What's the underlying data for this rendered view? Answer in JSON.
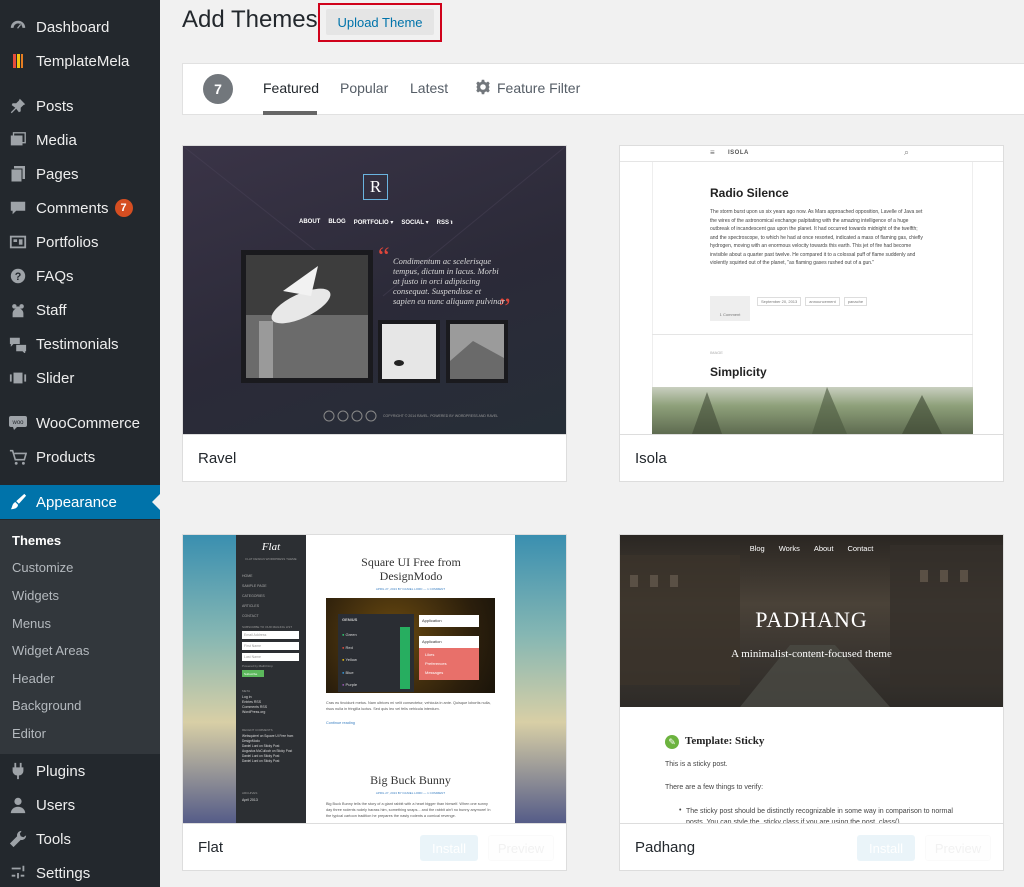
{
  "sidebar": {
    "items": [
      {
        "label": "Dashboard",
        "icon": "dashboard-icon"
      },
      {
        "label": "TemplateMela",
        "icon": "templatemela-icon"
      },
      {
        "label": "Posts",
        "icon": "pin-icon"
      },
      {
        "label": "Media",
        "icon": "media-icon"
      },
      {
        "label": "Pages",
        "icon": "pages-icon"
      },
      {
        "label": "Comments",
        "icon": "comment-icon",
        "badge": "7"
      },
      {
        "label": "Portfolios",
        "icon": "portfolio-icon"
      },
      {
        "label": "FAQs",
        "icon": "question-icon"
      },
      {
        "label": "Staff",
        "icon": "staff-icon"
      },
      {
        "label": "Testimonials",
        "icon": "testimonial-icon"
      },
      {
        "label": "Slider",
        "icon": "slider-icon"
      },
      {
        "label": "WooCommerce",
        "icon": "woocommerce-icon"
      },
      {
        "label": "Products",
        "icon": "cart-icon"
      },
      {
        "label": "Appearance",
        "icon": "brush-icon"
      },
      {
        "label": "Plugins",
        "icon": "plugin-icon"
      },
      {
        "label": "Users",
        "icon": "user-icon"
      },
      {
        "label": "Tools",
        "icon": "wrench-icon"
      },
      {
        "label": "Settings",
        "icon": "settings-icon"
      }
    ],
    "appearance_submenu": [
      "Themes",
      "Customize",
      "Widgets",
      "Menus",
      "Widget Areas",
      "Header",
      "Background",
      "Editor"
    ]
  },
  "header": {
    "title": "Add Themes",
    "upload_label": "Upload Theme"
  },
  "filter": {
    "count": "7",
    "tabs": [
      "Featured",
      "Popular",
      "Latest"
    ],
    "feature_filter": "Feature Filter"
  },
  "themes": [
    {
      "name": "Ravel",
      "preview": {
        "logo": "R",
        "nav": [
          "ABOUT",
          "BLOG",
          "PORTFOLIO ▾",
          "SOCIAL ▾",
          "RSS ℩"
        ],
        "quote": "Condimentum ac scelerisque tempus, dictum in lacus. Morbi at justo in orci adipiscing consequat. Suspendisse et sapien eu nunc aliquam pulvinar",
        "footer": "COPYRIGHT © 2014 RAVEL. POWERED BY WORDPRESS AND RAVEL"
      }
    },
    {
      "name": "Isola",
      "preview": {
        "brand": "ISOLA",
        "post_title": "Radio Silence",
        "post_body": "The storm burst upon us six years ago now. As Mars approached opposition, Lavelle of Java set the wires of the astronomical exchange palpitating with the amazing intelligence of a huge outbreak of incandescent gas upon the planet. It had occurred towards midnight of the twelfth; and the spectroscope, to which he had at once resorted, indicated a mass of flaming gas, chiefly hydrogen, moving with an enormous velocity towards this earth. This jet of fire had become invisible about a quarter past twelve. He compared it to a colossal puff of flame suddenly and violently squirted out of the planet, \"as flaming gases rushed out of a gun.\"",
        "meta": [
          "1 Comment",
          "September 20, 2013",
          "announcement",
          "panache"
        ],
        "second_kicker": "IMAGE",
        "second_title": "Simplicity"
      }
    },
    {
      "name": "Flat",
      "install": "Install",
      "preview_label": "Preview",
      "preview": {
        "logo": "Flat",
        "tagline": "FLAT DESIGN WORDPRESS THEME",
        "nav": [
          "HOME",
          "SAMPLE PAGE",
          "CATEGORIES",
          "ARTICLES",
          "CONTACT"
        ],
        "subscribe_heading": "SUBSCRIBE TO OUR MAILING LIST",
        "inputs": [
          "Email Address",
          "First Name",
          "Last Name"
        ],
        "powered": "Powered by MailChimp",
        "subscribe": "Subscribe",
        "meta_heading": "META",
        "meta_links": [
          "Log in",
          "Entries RSS",
          "Comments RSS",
          "WordPress.org"
        ],
        "recent_heading": "RECENT COMMENTS",
        "recent": [
          "Websquirrel on Square UI Free from DesignModo",
          "Daniel Lord on Sticky Post",
          "Augustus McCulloch on Sticky Post",
          "Daniel Lord on Sticky Post",
          "Daniel Lord on Sticky Post"
        ],
        "archives_heading": "ARCHIVES",
        "archives": [
          "April 2013"
        ],
        "post1_title": "Square UI Free from DesignModo",
        "post1_meta": "APRIL 27, 2013 BY DANIEL LORD — 1 COMMENT",
        "widget_title": "GENIUS",
        "widget_items": [
          "Green",
          "Red",
          "Yellow",
          "Blue",
          "Purple"
        ],
        "widget_apps": [
          "Application",
          "Application"
        ],
        "widget_menu": [
          "Likes",
          "Preferences",
          "Messages"
        ],
        "post1_excerpt": "Cras eu tincidunt metus. Nam ultrices mi velit consectetur, vehicula in ante. Quisque lobortis nulla, risus nulla in fringilla luctus. Sed quis leo vel felis vehicula interdum.",
        "continue": "Continue reading",
        "post2_title": "Big Buck Bunny",
        "post2_meta": "APRIL 27, 2013 BY DANIEL LORD — 1 COMMENT",
        "post2_excerpt": "Big Buck Bunny tells the story of a giant rabbit with a heart bigger than himself. When one sunny day three rodents rudely harass him, something snaps... and the rabbit ain't no bunny anymore! In the typical cartoon tradition he prepares the nasty rodents a comical revenge."
      }
    },
    {
      "name": "Padhang",
      "install": "Install",
      "preview_label": "Preview",
      "preview": {
        "nav": [
          "Blog",
          "Works",
          "About",
          "Contact"
        ],
        "title": "PADHANG",
        "tagline": "A minimalist-content-focused theme",
        "post_title": "Template: Sticky",
        "p1": "This is a sticky post.",
        "p2": "There are a few things to verify:",
        "li1": "The sticky post should be distinctly recognizable in some way in comparison to normal posts. You can style the .sticky class if you are using the post_class()"
      }
    }
  ]
}
